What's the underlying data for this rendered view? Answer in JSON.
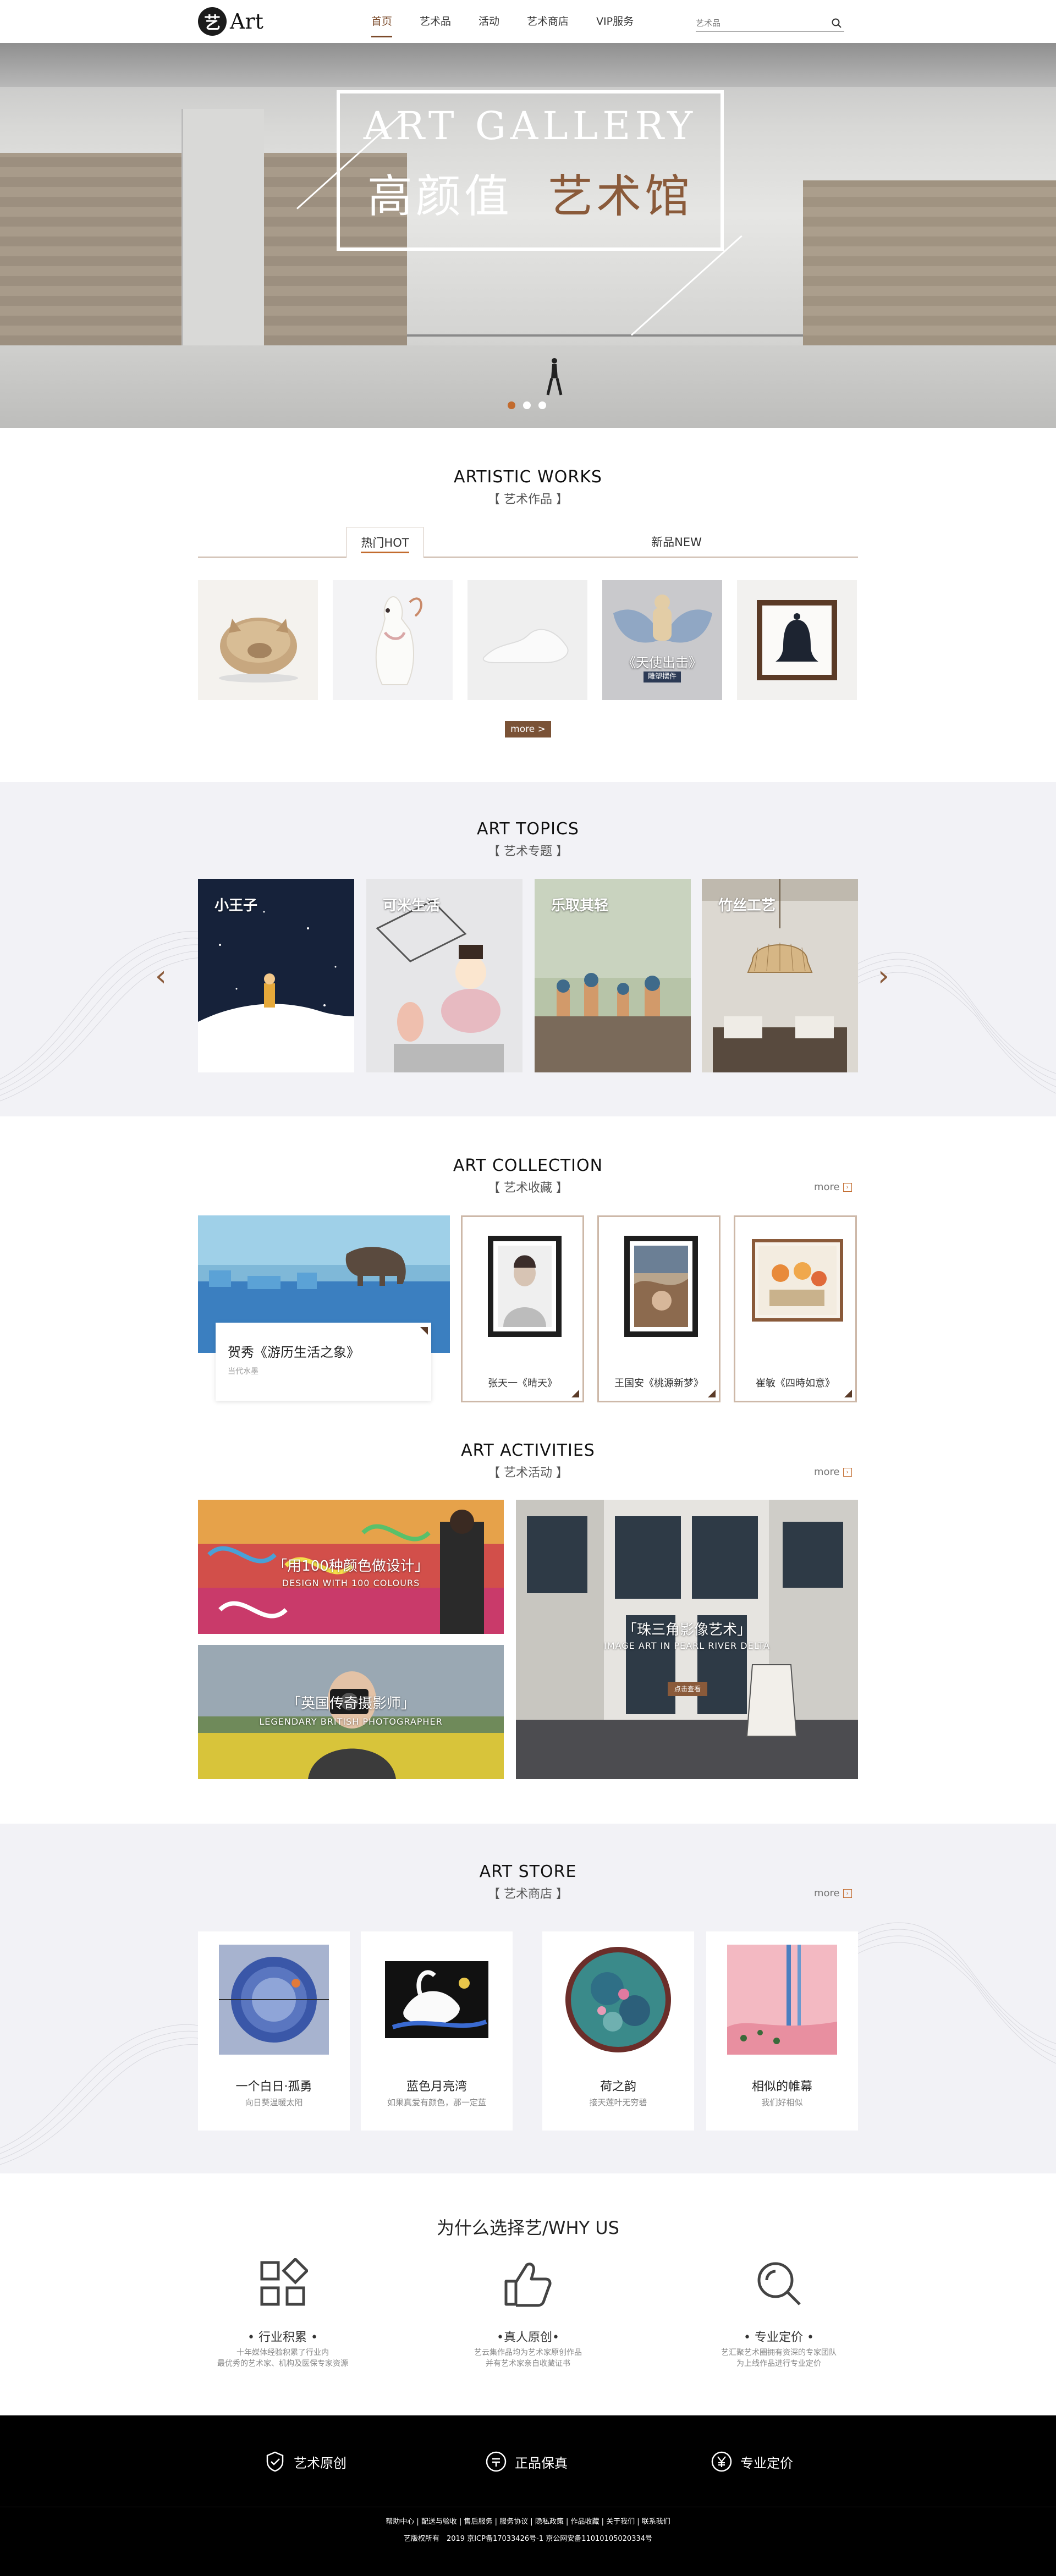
{
  "header": {
    "logo_mark": "艺",
    "logo_text": "Art",
    "nav": [
      {
        "label": "首页",
        "active": true
      },
      {
        "label": "艺术品",
        "active": false
      },
      {
        "label": "活动",
        "active": false
      },
      {
        "label": "艺术商店",
        "active": false
      },
      {
        "label": "VIP服务",
        "active": false
      }
    ],
    "search_placeholder": "艺术品"
  },
  "hero": {
    "title_en": "ART GALLERY",
    "title_cn_left": "高颜值",
    "title_cn_right": "艺术馆",
    "slides": 3,
    "active_slide": 1
  },
  "works": {
    "title": "ARTISTIC WORKS",
    "subtitle": "艺术作品",
    "tabs": [
      "热门HOT",
      "新品NEW"
    ],
    "active_tab": "热门HOT",
    "overlay_title": "《天使出击》",
    "overlay_sub": "雕塑摆件",
    "more_label": "more >"
  },
  "topics": {
    "title": "ART TOPICS",
    "subtitle": "艺术专题",
    "items": [
      "小王子",
      "可米生活",
      "乐取其轻",
      "竹丝工艺"
    ]
  },
  "collection": {
    "title": "ART COLLECTION",
    "subtitle": "艺术收藏",
    "more_label": "more",
    "featured_title": "贺秀《游历生活之象》",
    "featured_sub": "当代水墨",
    "items": [
      "张天一《晴天》",
      "王国安《桃源新梦》",
      "崔敏《四時如意》"
    ]
  },
  "activities": {
    "title": "ART ACTIVITIES",
    "subtitle": "艺术活动",
    "more_label": "more",
    "items": [
      {
        "title": "「用100种颜色做设计」",
        "sub": "DESIGN WITH 100 COLOURS"
      },
      {
        "title": "「英国传奇摄影师」",
        "sub": "LEGENDARY BRITISH PHOTOGRAPHER"
      },
      {
        "title": "「珠三角影像艺术」",
        "sub": "IMAGE ART IN PEARL RIVER DELTA",
        "button": "点击查看"
      }
    ]
  },
  "store": {
    "title": "ART STORE",
    "subtitle": "艺术商店",
    "more_label": "more",
    "items": [
      {
        "name": "一个白日·孤勇",
        "desc": "向日葵温暖太阳"
      },
      {
        "name": "蓝色月亮湾",
        "desc": "如果真爱有颜色，那一定蓝"
      },
      {
        "name": "荷之韵",
        "desc": "接天莲叶无穷碧"
      },
      {
        "name": "相似的帷幕",
        "desc": "我们好相似"
      }
    ]
  },
  "why": {
    "title": "为什么选择艺/WHY US",
    "items": [
      {
        "name": "• 行业积累 •",
        "desc1": "十年媒体经验积累了行业内",
        "desc2": "最优秀的艺术家、机构及医保专家资源"
      },
      {
        "name": "•真人原创•",
        "desc1": "艺云集作品均为艺术家原创作品",
        "desc2": "并有艺术家亲自收藏证书"
      },
      {
        "name": "• 专业定价 •",
        "desc1": "艺汇聚艺术圈拥有资深的专家团队",
        "desc2": "为上线作品进行专业定价"
      }
    ]
  },
  "footer": {
    "badges": [
      {
        "icon": "shield-check",
        "label": "艺术原创"
      },
      {
        "icon": "guarantee-circle",
        "label": "正品保真"
      },
      {
        "icon": "yuan-circle",
        "label": "专业定价"
      }
    ],
    "links": "帮助中心 | 配送与验收 | 售后服务 | 服务协议 | 隐私政策 | 作品收藏 | 关于我们 | 联系我们",
    "copyright": "艺版权所有　2019 京ICP备17033426号-1 京公网安备11010105020334号"
  }
}
